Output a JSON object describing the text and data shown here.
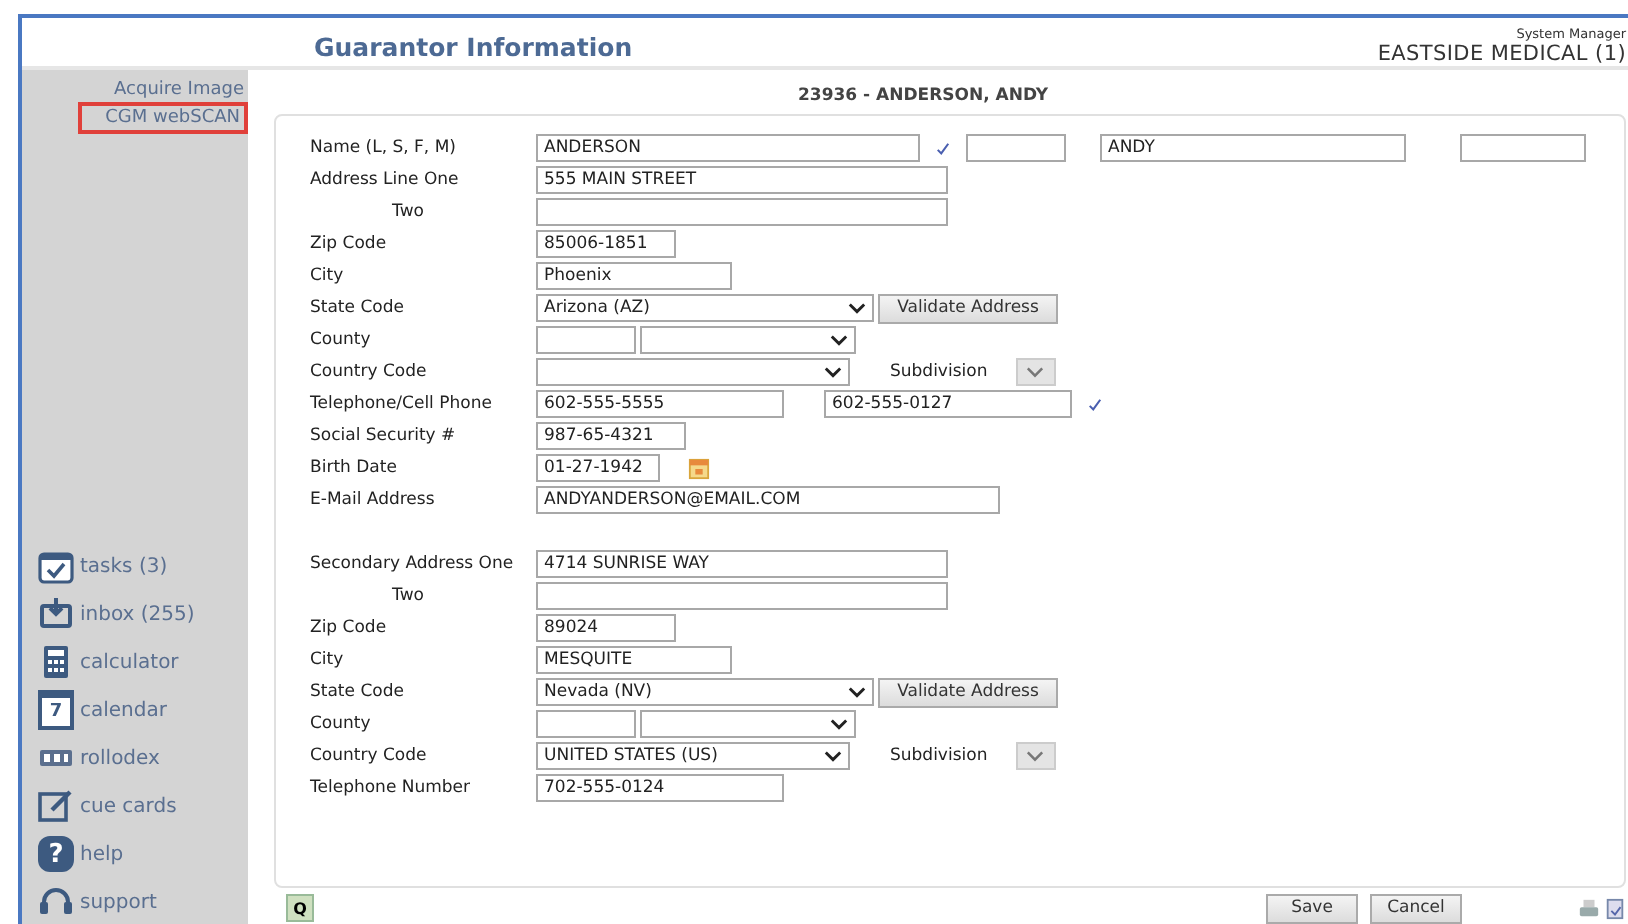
{
  "header": {
    "title": "Guarantor Information",
    "user": "System Manager",
    "practice": "EASTSIDE MEDICAL (1)"
  },
  "sidebar": {
    "links": [
      {
        "label": "Acquire Image",
        "highlighted": false
      },
      {
        "label": "CGM webSCAN",
        "highlighted": true
      }
    ],
    "nav": [
      {
        "kind": "tasks",
        "label": "tasks (3)"
      },
      {
        "kind": "inbox",
        "label": "inbox (255)"
      },
      {
        "kind": "calculator",
        "label": "calculator"
      },
      {
        "kind": "calendar",
        "icon_text": "7",
        "label": "calendar"
      },
      {
        "kind": "rolodex",
        "label": "rollodex"
      },
      {
        "kind": "cards",
        "label": "cue cards"
      },
      {
        "kind": "help",
        "icon_text": "?",
        "label": "help"
      },
      {
        "kind": "support",
        "label": "support"
      }
    ]
  },
  "record_title": "23936 - ANDERSON, ANDY",
  "sections": [
    {
      "rows": [
        {
          "kind": "name",
          "label": "Name (L, S, F, M)",
          "last": "ANDERSON",
          "first": "ANDY",
          "verified": true
        },
        {
          "kind": "address",
          "label": "Address Line One",
          "value": "555 MAIN STREET"
        },
        {
          "kind": "continuation",
          "label": "Two"
        },
        {
          "kind": "zip",
          "label": "Zip Code",
          "value": "85006-1851"
        },
        {
          "kind": "city",
          "label": "City",
          "value": "Phoenix"
        },
        {
          "kind": "state",
          "label": "State Code",
          "value": "Arizona (AZ)",
          "button": "Validate Address"
        },
        {
          "kind": "county",
          "label": "County"
        },
        {
          "kind": "country",
          "label": "Country Code",
          "sub_label": "Subdivision"
        },
        {
          "kind": "phone",
          "label": "Telephone/Cell Phone",
          "values": [
            "602-555-5555",
            "602-555-0127"
          ],
          "verified": true
        },
        {
          "kind": "ssn",
          "label": "Social Security #",
          "value": "987-65-4321"
        },
        {
          "kind": "date",
          "label": "Birth Date",
          "value": "01-27-1942"
        },
        {
          "kind": "email",
          "label": "E-Mail Address",
          "value": "ANDYANDERSON@EMAIL.COM"
        }
      ]
    },
    {
      "rows": [
        {
          "kind": "address",
          "label": "Secondary Address One",
          "value": "4714 SUNRISE WAY"
        },
        {
          "kind": "continuation",
          "label": "Two"
        },
        {
          "kind": "zip",
          "label": "Zip Code",
          "value": "89024"
        },
        {
          "kind": "city",
          "label": "City",
          "value": "MESQUITE"
        },
        {
          "kind": "state",
          "label": "State Code",
          "value": "Nevada (NV)",
          "button": "Validate Address"
        },
        {
          "kind": "county",
          "label": "County"
        },
        {
          "kind": "country",
          "label": "Country Code",
          "value": "UNITED STATES (US)",
          "sub_label": "Subdivision"
        },
        {
          "kind": "phone",
          "label": "Telephone Number",
          "values": [
            "702-555-0124"
          ]
        }
      ]
    }
  ],
  "footer": {
    "quick_button": "Q",
    "buttons": [
      "Save",
      "Cancel"
    ]
  }
}
